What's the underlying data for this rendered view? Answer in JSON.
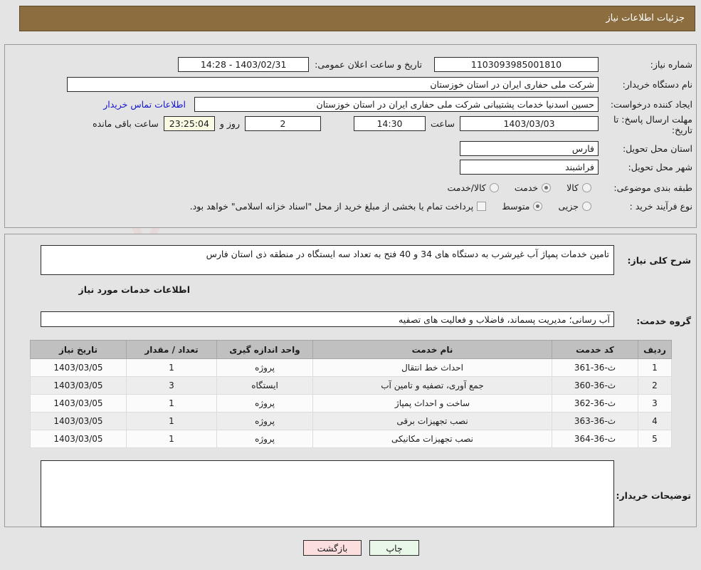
{
  "header": {
    "title": "جزئیات اطلاعات نیاز"
  },
  "form": {
    "need_number_label": "شماره نیاز:",
    "need_number_value": "1103093985001810",
    "announce_label": "تاریخ و ساعت اعلان عمومی:",
    "announce_value": "1403/02/31 - 14:28",
    "buyer_org_label": "نام دستگاه خریدار:",
    "buyer_org_value": "شرکت ملی حفاری ایران در استان خوزستان",
    "creator_label": "ایجاد کننده درخواست:",
    "creator_value": "حسین اسدنیا خدمات پشتیبانی شرکت ملی حفاری ایران در استان خوزستان",
    "contact_link": "اطلاعات تماس خریدار",
    "deadline_label_l1": "مهلت ارسال پاسخ: تا",
    "deadline_label_l2": "تاریخ:",
    "deadline_date": "1403/03/03",
    "hour_label": "ساعت",
    "deadline_time": "14:30",
    "days_value": "2",
    "days_label": "روز و",
    "countdown_value": "23:25:04",
    "countdown_label": "ساعت باقی مانده",
    "province_label": "استان محل تحویل:",
    "province_value": "فارس",
    "city_label": "شهر محل تحویل:",
    "city_value": "فراشبند",
    "category_label": "طبقه بندی موضوعی:",
    "category_options": [
      {
        "label": "کالا",
        "selected": false
      },
      {
        "label": "خدمت",
        "selected": true
      },
      {
        "label": "کالا/خدمت",
        "selected": false
      }
    ],
    "process_label": "نوع فرآیند خرید :",
    "process_options": [
      {
        "label": "جزیی",
        "selected": false
      },
      {
        "label": "متوسط",
        "selected": true
      }
    ],
    "treasury_checkbox_label": "پرداخت تمام یا بخشی از مبلغ خرید از محل \"اسناد خزانه اسلامی\" خواهد بود.",
    "treasury_checked": false
  },
  "description": {
    "label": "شرح کلی نیاز:",
    "value": "تامین خدمات پمپاژ آب غیرشرب به دستگاه های 34 و 40 فتح به تعداد سه ایستگاه در منطقه ذی استان فارس"
  },
  "services_section": {
    "title": "اطلاعات خدمات مورد نیاز",
    "group_label": "گروه خدمت:",
    "group_value": "آب رسانی؛ مدیریت پسماند، فاضلاب و فعالیت های تصفیه"
  },
  "table": {
    "headers": [
      "ردیف",
      "کد خدمت",
      "نام خدمت",
      "واحد اندازه گیری",
      "تعداد / مقدار",
      "تاریخ نیاز"
    ],
    "rows": [
      {
        "row": "1",
        "code": "ث-36-361",
        "name": "احداث خط انتقال",
        "unit": "پروژه",
        "qty": "1",
        "date": "1403/03/05"
      },
      {
        "row": "2",
        "code": "ث-36-360",
        "name": "جمع آوری، تصفیه و تامین آب",
        "unit": "ایستگاه",
        "qty": "3",
        "date": "1403/03/05"
      },
      {
        "row": "3",
        "code": "ث-36-362",
        "name": "ساخت و احداث پمپاژ",
        "unit": "پروژه",
        "qty": "1",
        "date": "1403/03/05"
      },
      {
        "row": "4",
        "code": "ث-36-363",
        "name": "نصب تجهیزات برقی",
        "unit": "پروژه",
        "qty": "1",
        "date": "1403/03/05"
      },
      {
        "row": "5",
        "code": "ث-36-364",
        "name": "نصب تجهیزات مکانیکی",
        "unit": "پروژه",
        "qty": "1",
        "date": "1403/03/05"
      }
    ]
  },
  "buyer_notes": {
    "label": "توضیحات خریدار:",
    "value": ""
  },
  "footer": {
    "print_label": "چاپ",
    "back_label": "بازگشت"
  },
  "watermark": {
    "text": "AriaTender.net"
  },
  "colors": {
    "header_bar": "#8c6d3f",
    "page_bg": "#e4e4e4",
    "link": "#1414cf",
    "table_header": "#c0c0c0",
    "print_btn": "#e9f7e9",
    "back_btn": "#fbdede",
    "countdown_bg": "#fbfbe4"
  }
}
